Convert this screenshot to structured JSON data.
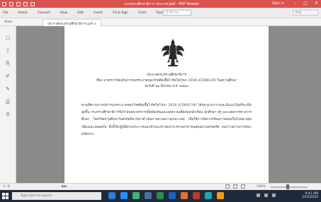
{
  "app": {
    "title": "กระทรวงศึกษาธิการ ประกาศ.pdf - PDF Reader",
    "sign_in": "Sign in"
  },
  "menu": {
    "tabs": [
      "File",
      "Home",
      "Convert",
      "View",
      "Edit",
      "Insert",
      "Fill & Sign",
      "Form",
      "Tools",
      "Help"
    ],
    "search_placeholder": "Q Tell me",
    "right_box": "Find"
  },
  "doc_tabs": {
    "home": "Start",
    "current": "ประกาศกระทรวงศึกษาธิการ.pdf"
  },
  "document": {
    "title_line1": "ประกาศกระทรวงศึกษาธิการ",
    "title_line2": "เรื่อง มาตรการป้องกันการแพร่ระบาดของโรคติดเชื้อไวรัสโคโรนา 2019 (COVID-19) ในสถานศึกษา",
    "title_line3": "ลงวันที่ ๑๖ มีนาคม พ.ศ. ๒๕๖๓",
    "paragraph": "ตามที่สถานการณ์การแพร่ระบาดของโรคติดเชื้อไวรัสโคโรนา 2019 (COVID-19) ได้ขยายวงกว้างและมีแนวโน้มที่จะเพิ่มสูงขึ้น กระทรวงศึกษาธิการจึงกำหนดมาตรการเพื่อป้องกันและลดความเสี่ยงของนักเรียน นักศึกษา ครู และบุคลากรทางการศึกษา โดยให้สถานศึกษาในสังกัดพิจารณาดำเนินการตามความเหมาะสม เพื่อให้การจัดการเรียนการสอนเป็นไปอย่างต่อเนื่องและปลอดภัย ทั้งนี้ให้ปฏิบัติตามประกาศและคำแนะนำของกระทรวงสาธารณสุขอย่างเคร่งครัด จนกว่าสถานการณ์จะคลี่คลาย"
  },
  "status": {
    "page_info": "1 / 6",
    "nav": "◀  ▶",
    "zoom": "100%"
  },
  "taskbar": {
    "search_placeholder": "Type here to search",
    "time": "9:41 AM",
    "date": "3/16/2020"
  },
  "colors": {
    "title_bar": "#d9534f",
    "workspace": "#8a8a8a",
    "taskbar": "#1f2b3a"
  }
}
